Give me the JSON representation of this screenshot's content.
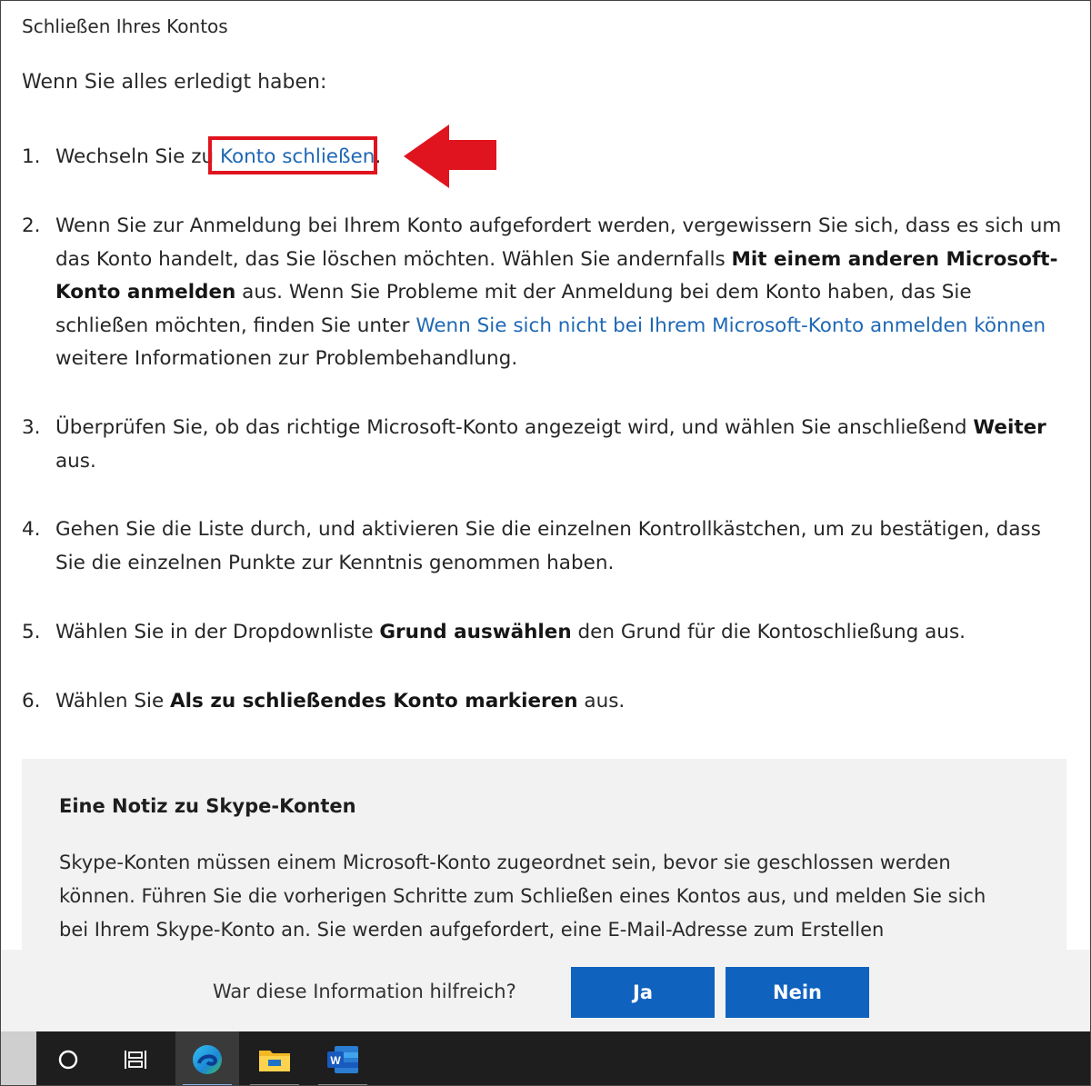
{
  "section_title": "Schließen Ihres Kontos",
  "intro": "Wenn Sie alles erledigt haben:",
  "steps": [
    {
      "num": "1.",
      "a": "Wechseln Sie zu ",
      "link": "Konto schließen",
      "b": "."
    },
    {
      "num": "2.",
      "a": "Wenn Sie zur Anmeldung bei Ihrem Konto aufgefordert werden, vergewissern Sie sich, dass es sich um das Konto handelt, das Sie löschen möchten. Wählen Sie andernfalls ",
      "bold": "Mit einem anderen Microsoft-Konto anmelden",
      "b": " aus. Wenn Sie Probleme mit der Anmeldung bei dem Konto haben, das Sie schließen möchten, finden Sie unter ",
      "link": "Wenn Sie sich nicht bei Ihrem Microsoft-Konto anmelden können",
      "c": " weitere Informationen zur Problembehandlung."
    },
    {
      "num": "3.",
      "a": "Überprüfen Sie, ob das richtige Microsoft-Konto angezeigt wird, und wählen Sie anschließend ",
      "bold": "Weiter",
      "b": " aus."
    },
    {
      "num": "4.",
      "a": "Gehen Sie die Liste durch, und aktivieren Sie die einzelnen Kontrollkästchen, um zu bestätigen, dass Sie die einzelnen Punkte zur Kenntnis genommen haben."
    },
    {
      "num": "5.",
      "a": "Wählen Sie in der Dropdownliste ",
      "bold": "Grund auswählen",
      "b": " den Grund für die Kontoschließung aus."
    },
    {
      "num": "6.",
      "a": "Wählen Sie ",
      "bold": "Als zu schließendes Konto markieren",
      "b": " aus."
    }
  ],
  "note": {
    "title": "Eine Notiz zu Skype-Konten",
    "body": "Skype-Konten müssen einem Microsoft-Konto zugeordnet sein, bevor sie geschlossen werden können. Führen Sie die vorherigen Schritte zum Schließen eines Kontos aus, und melden Sie sich bei Ihrem Skype-Konto an. Sie werden aufgefordert, eine E-Mail-Adresse zum Erstellen"
  },
  "feedback": {
    "question": "War diese Information hilfreich?",
    "yes": "Ja",
    "no": "Nein"
  },
  "colors": {
    "link": "#1f68b5",
    "highlight": "#e0141e",
    "button": "#0f62be",
    "taskbar": "#1e1e1e"
  },
  "taskbar_icons": [
    "cortana-circle-icon",
    "task-view-icon",
    "edge-icon",
    "file-explorer-icon",
    "word-icon"
  ]
}
